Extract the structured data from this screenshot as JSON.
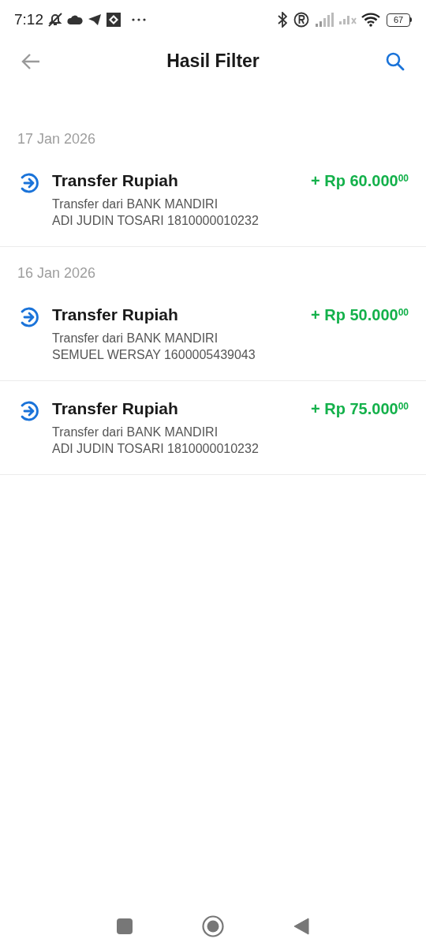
{
  "status_bar": {
    "time": "7:12",
    "battery": "67"
  },
  "header": {
    "title": "Hasil Filter"
  },
  "groups": [
    {
      "date": "17 Jan 2026",
      "transactions": [
        {
          "title": "Transfer Rupiah",
          "amount": "+ Rp 60.000$^{00}$",
          "line_1": "Transfer dari BANK MANDIRI",
          "line_2": "ADI JUDIN TOSARI 1810000010232"
        }
      ]
    },
    {
      "date": "16 Jan 2026",
      "transactions": [
        {
          "title": "Transfer Rupiah",
          "amount": "+ Rp 50.000$^{00}$",
          "line_1": "Transfer dari BANK MANDIRI",
          "line_2": "SEMUEL WERSAY 1600005439043"
        },
        {
          "title": "Transfer Rupiah",
          "amount": "+ Rp 75.000$^{00}$",
          "line_1": "Transfer dari BANK MANDIRI",
          "line_2": "ADI JUDIN TOSARI 1810000010232"
        }
      ]
    }
  ]
}
